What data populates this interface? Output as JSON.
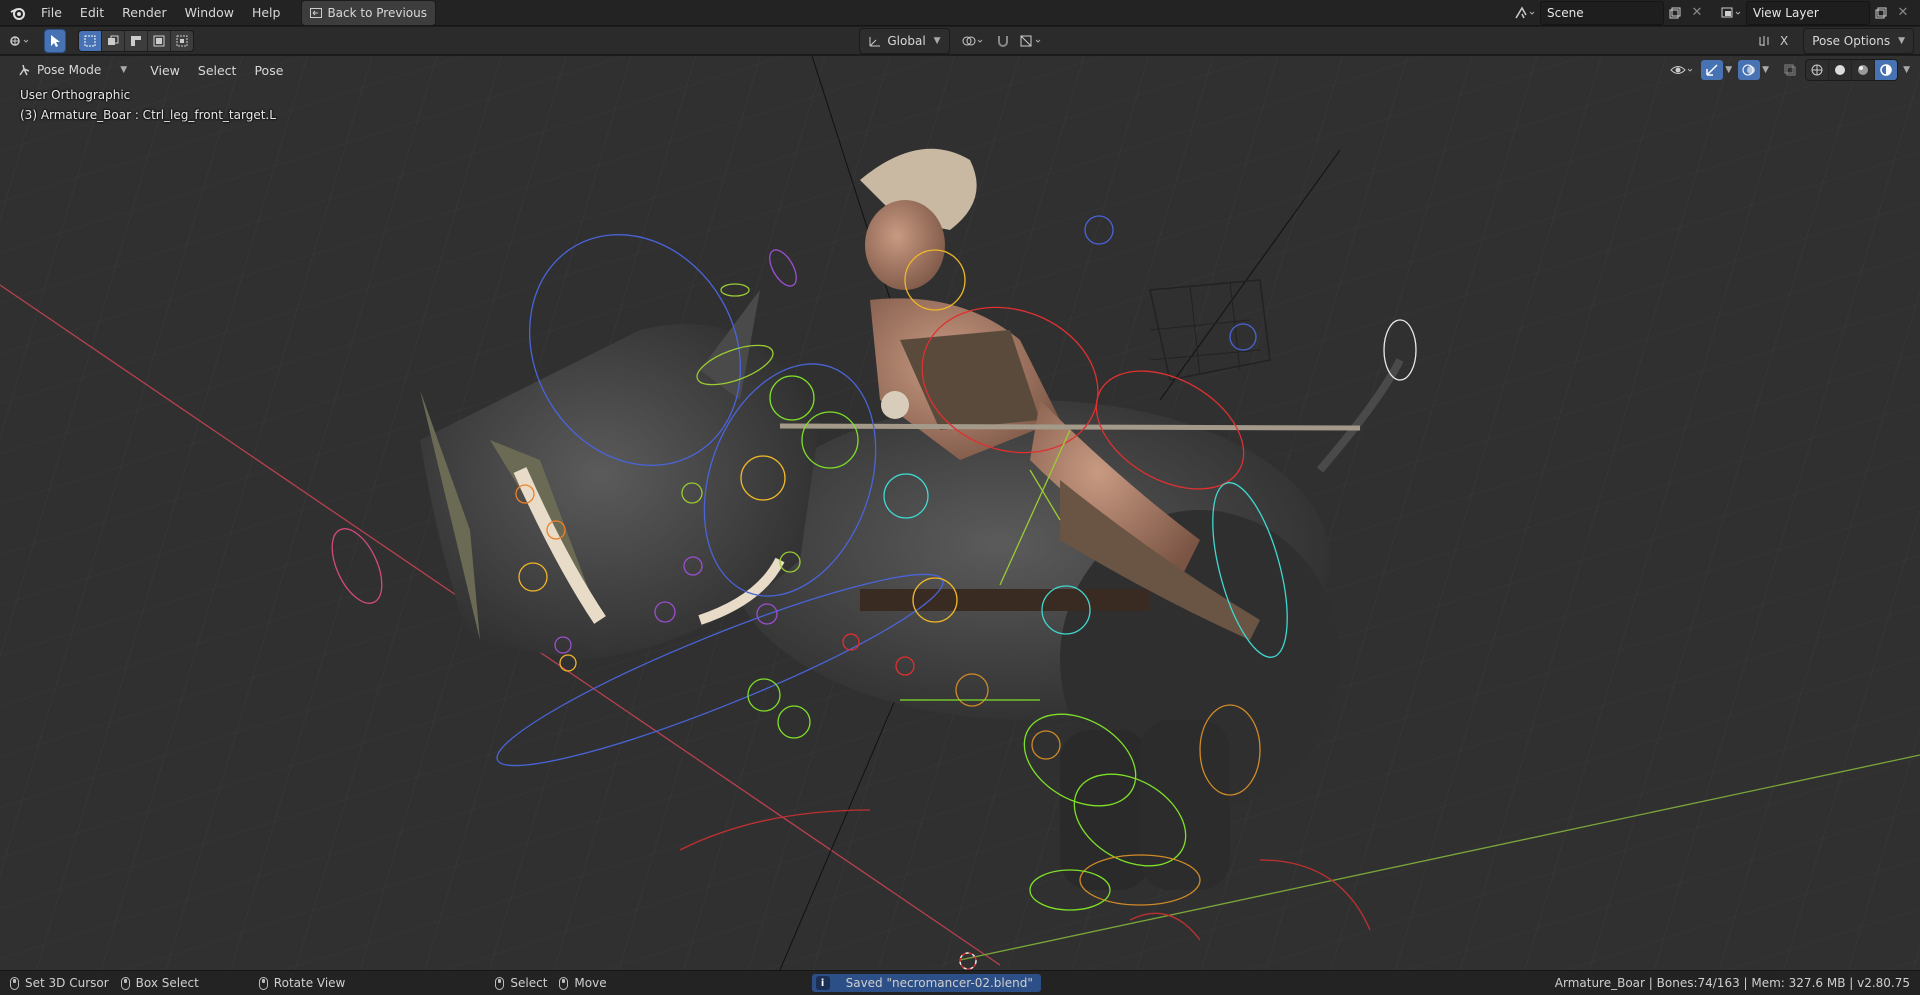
{
  "app": {
    "menus": [
      "File",
      "Edit",
      "Render",
      "Window",
      "Help"
    ],
    "back_button": "Back to Previous",
    "scene": "Scene",
    "view_layer": "View Layer"
  },
  "toolbar": {
    "transform_orientation": "Global",
    "axis_x": "X",
    "pose_options": "Pose Options"
  },
  "viewport_header": {
    "mode": "Pose Mode",
    "menus": [
      "View",
      "Select",
      "Pose"
    ]
  },
  "viewport": {
    "view_name": "User Orthographic",
    "active_object": "(3) Armature_Boar : Ctrl_leg_front_target.L"
  },
  "statusbar": {
    "left": [
      "Set 3D Cursor",
      "Box Select",
      "Rotate View"
    ],
    "mid": [
      "Select",
      "Move"
    ],
    "report": "Saved \"necromancer-02.blend\"",
    "stats": "Armature_Boar | Bones:74/163 | Mem: 327.6 MB | v2.80.75"
  },
  "colors": {
    "accent": "#4772b3",
    "x_axis": "#b8404f",
    "y_axis": "#7aa53a"
  }
}
